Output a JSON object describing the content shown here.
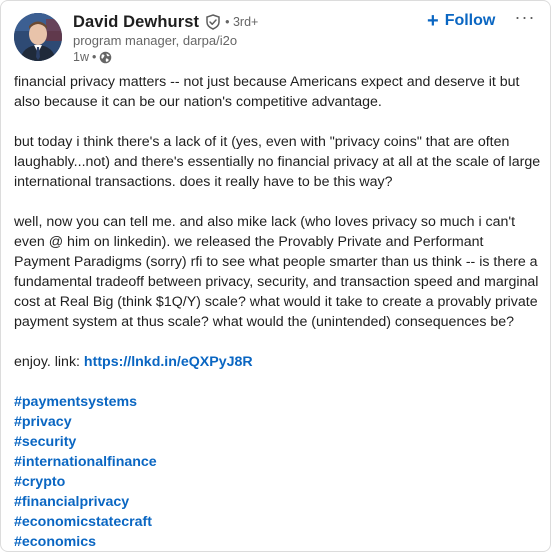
{
  "author": {
    "name": "David Dewhurst",
    "connection_degree": "3rd+",
    "degree_separator": "•",
    "headline": "program manager, darpa/i2o",
    "time_ago": "1w",
    "meta_separator": "•",
    "verified_icon": "shield-check-icon",
    "visibility_icon": "globe-icon"
  },
  "actions": {
    "follow_label": "Follow",
    "follow_plus": "+",
    "more_label": "···"
  },
  "post": {
    "paragraph_1": "financial privacy matters -- not just because Americans expect and deserve it but also because it can be our nation's competitive advantage.",
    "paragraph_2": "but today i think there's a lack of it (yes, even with \"privacy coins\" that are often laughably...not) and there's essentially no financial privacy at all at the scale of large international transactions. does it really have to be this way?",
    "paragraph_3": "well, now you can tell me. and also mike lack (who loves privacy so much i can't even @ him on linkedin). we released the Provably Private and Performant Payment Paradigms (sorry) rfi to see what people smarter than us think -- is there a fundamental tradeoff between privacy, security, and transaction speed and marginal cost at Real Big (think $1Q/Y) scale? what would it take to create a provably private payment system at thus scale? what would the (unintended) consequences be?",
    "link_prefix": "enjoy. link: ",
    "link_text": "https://lnkd.in/eQXPyJ8R",
    "hashtags": [
      "#paymentsystems",
      "#privacy",
      "#security",
      "#internationalfinance",
      "#crypto",
      "#financialprivacy",
      "#economicstatecraft",
      "#economics"
    ]
  },
  "colors": {
    "link_blue": "#0a66c2",
    "text": "#1f1f1f",
    "muted": "#666666"
  }
}
